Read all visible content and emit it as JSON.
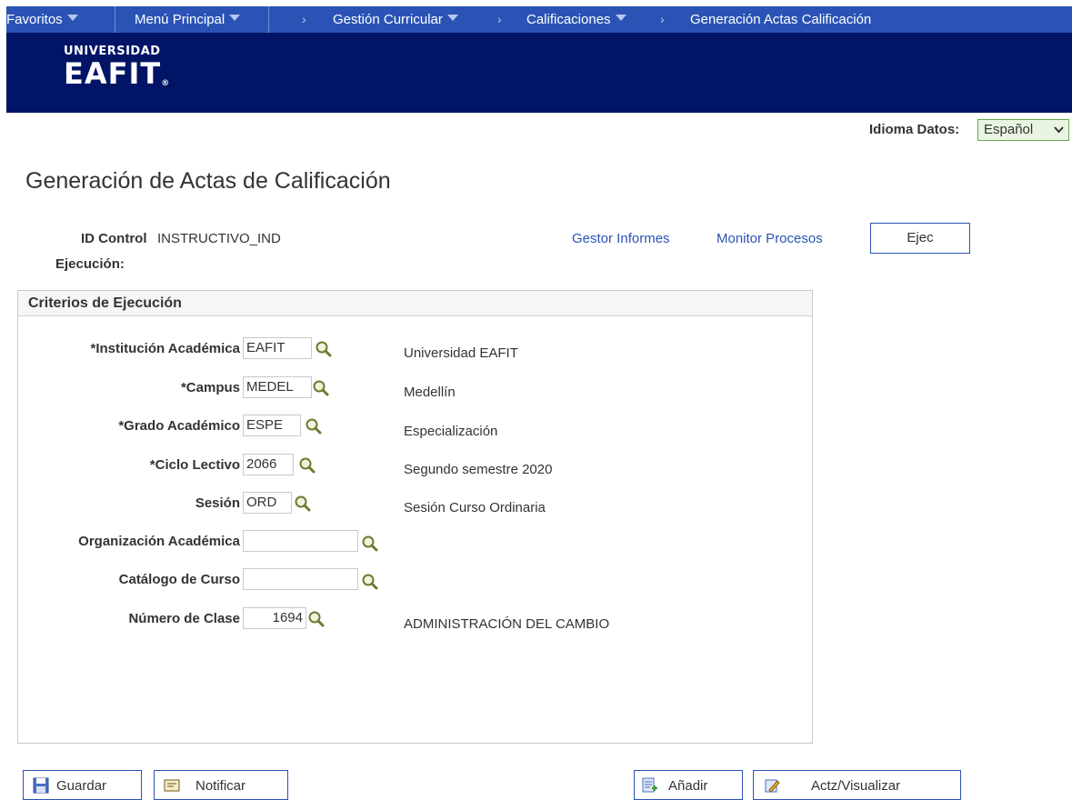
{
  "nav": {
    "favoritos": "Favoritos",
    "menu_principal": "Menú Principal",
    "chevron": "›",
    "gestion_curricular": "Gestión Curricular",
    "calificaciones": "Calificaciones",
    "current": "Generación Actas Calificación"
  },
  "banner": {
    "logo_line1": "UNIVERSIDAD",
    "logo_line2": "EAFIT",
    "logo_reg": "®"
  },
  "language": {
    "label": "Idioma Datos:",
    "selected": "Español",
    "chevron": "⌄"
  },
  "page_title": "Generación de Actas de Calificación",
  "run_control": {
    "label_line1": "ID Control",
    "label_line2": "Ejecución:",
    "value": "INSTRUCTIVO_IND",
    "report_manager": "Gestor Informes",
    "process_monitor": "Monitor Procesos",
    "run_button": "Ejec"
  },
  "criteria": {
    "title": "Criterios de Ejecución",
    "fields": [
      {
        "label": "*Institución Académica",
        "value": "EAFIT",
        "description": "Universidad EAFIT"
      },
      {
        "label": "*Campus",
        "value": "MEDEL",
        "description": "Medellín"
      },
      {
        "label": "*Grado Académico",
        "value": "ESPE",
        "description": "Especialización"
      },
      {
        "label": "*Ciclo Lectivo",
        "value": "2066",
        "description": "Segundo semestre 2020"
      },
      {
        "label": "Sesión",
        "value": "ORD",
        "description": "Sesión Curso Ordinaria"
      },
      {
        "label": "Organización Académica",
        "value": "",
        "description": ""
      },
      {
        "label": "Catálogo de Curso",
        "value": "",
        "description": ""
      },
      {
        "label": "Número de Clase",
        "value": "1694",
        "description": "ADMINISTRACIÓN DEL CAMBIO"
      }
    ]
  },
  "toolbar": {
    "save": "Guardar",
    "notify": "Notificar",
    "add": "Añadir",
    "update_display": "Actz/Visualizar"
  },
  "colors": {
    "nav_blue": "#2a53b5",
    "banner_navy": "#011466",
    "link_blue": "#2a53b5",
    "lang_green": "#6aa84f"
  },
  "icons": {
    "lookup": "magnifier-icon",
    "save": "floppy-disk-icon",
    "notify": "envelope-icon",
    "add": "add-document-icon",
    "update": "edit-pencil-icon",
    "dropdown": "caret-down-icon"
  }
}
